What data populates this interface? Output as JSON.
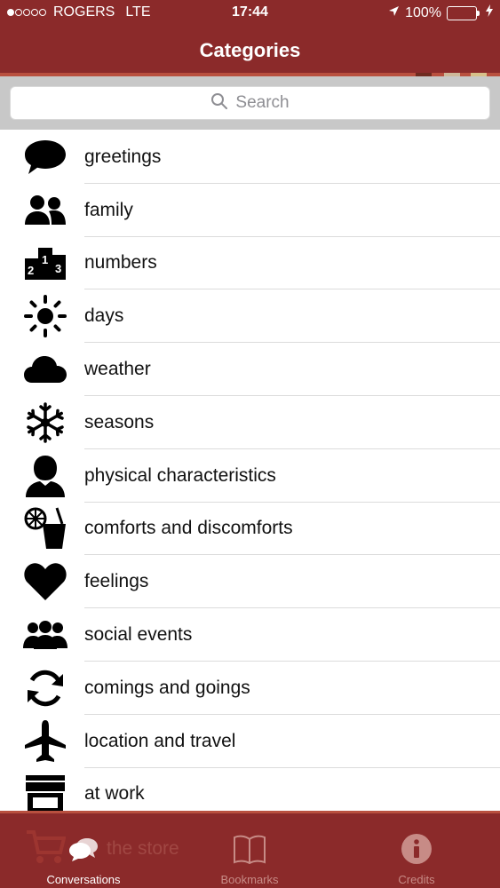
{
  "status_bar": {
    "carrier": "ROGERS",
    "network": "LTE",
    "time": "17:44",
    "battery": "100%"
  },
  "nav": {
    "title": "Categories"
  },
  "search": {
    "placeholder": "Search"
  },
  "categories": [
    {
      "label": "greetings",
      "icon": "speech-bubble-icon"
    },
    {
      "label": "family",
      "icon": "people-icon"
    },
    {
      "label": "numbers",
      "icon": "numbers-podium-icon"
    },
    {
      "label": "days",
      "icon": "sun-icon"
    },
    {
      "label": "weather",
      "icon": "cloud-icon"
    },
    {
      "label": "seasons",
      "icon": "snowflake-icon"
    },
    {
      "label": "physical characteristics",
      "icon": "person-silhouette-icon"
    },
    {
      "label": "comforts and discomforts",
      "icon": "drink-icon"
    },
    {
      "label": "feelings",
      "icon": "heart-icon"
    },
    {
      "label": "social events",
      "icon": "group-icon"
    },
    {
      "label": "comings and goings",
      "icon": "refresh-arrows-icon"
    },
    {
      "label": "location and travel",
      "icon": "airplane-icon"
    },
    {
      "label": "at work",
      "icon": "storefront-icon"
    }
  ],
  "tabbar": {
    "ghost_text": "the store",
    "tabs": [
      {
        "label": "Conversations",
        "icon": "chat-bubbles-icon",
        "active": true
      },
      {
        "label": "Bookmarks",
        "icon": "book-icon",
        "active": false
      },
      {
        "label": "Credits",
        "icon": "info-icon",
        "active": false
      }
    ]
  },
  "colors": {
    "header_bg": "#8b2a2a",
    "accent_stripe": "#b9503f",
    "battery_fill": "#4cd964",
    "inactive_tab": "#c78b86"
  }
}
